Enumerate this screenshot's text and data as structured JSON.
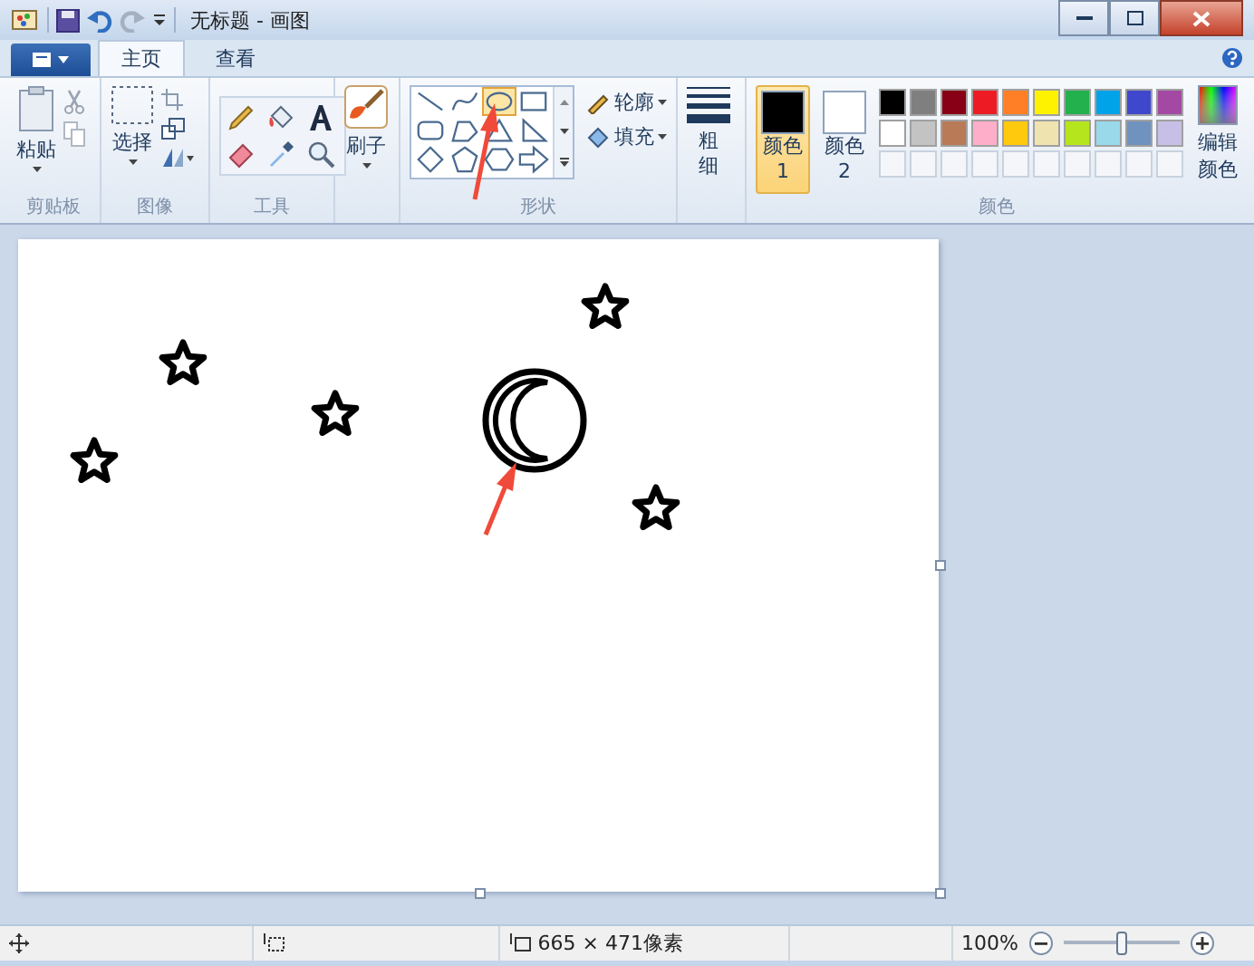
{
  "window": {
    "title": "无标题 - 画图"
  },
  "tabs": [
    {
      "label": "主页",
      "selected": true
    },
    {
      "label": "查看",
      "selected": false
    }
  ],
  "ribbon": {
    "clipboard": {
      "paste": "粘贴",
      "label": "剪贴板"
    },
    "image": {
      "select": "选择",
      "label": "图像"
    },
    "tools": {
      "label": "工具"
    },
    "brushes": {
      "label": "刷子"
    },
    "shapes": {
      "items": [
        {
          "kind": "line",
          "selected": false
        },
        {
          "kind": "curve",
          "selected": false
        },
        {
          "kind": "oval",
          "selected": true
        },
        {
          "kind": "rectangle",
          "selected": false
        },
        {
          "kind": "rounded",
          "selected": false
        },
        {
          "kind": "polygon",
          "selected": false
        },
        {
          "kind": "triangle",
          "selected": false
        },
        {
          "kind": "right-triangle",
          "selected": false
        },
        {
          "kind": "diamond",
          "selected": false
        },
        {
          "kind": "pentagon",
          "selected": false
        },
        {
          "kind": "hexagon",
          "selected": false
        },
        {
          "kind": "arrow",
          "selected": false
        }
      ],
      "outline": "轮廓",
      "fill": "填充",
      "label": "形状"
    },
    "size": {
      "label": "粗细"
    },
    "colors": {
      "color1": {
        "label": "颜色 1",
        "selected": true,
        "color": "#000000"
      },
      "color2": {
        "label": "颜色 2",
        "selected": false,
        "color": "#ffffff"
      },
      "palette": [
        {
          "color": "#000000"
        },
        {
          "color": "#7f7f7f"
        },
        {
          "color": "#880015"
        },
        {
          "color": "#ed1c24"
        },
        {
          "color": "#ff7f27"
        },
        {
          "color": "#fff200"
        },
        {
          "color": "#22b14c"
        },
        {
          "color": "#00a2e8"
        },
        {
          "color": "#3f48cc"
        },
        {
          "color": "#a349a4"
        },
        {
          "color": "#ffffff"
        },
        {
          "color": "#c3c3c3"
        },
        {
          "color": "#b97a57"
        },
        {
          "color": "#ffaec9"
        },
        {
          "color": "#ffc90e"
        },
        {
          "color": "#efe4b0"
        },
        {
          "color": "#b5e61d"
        },
        {
          "color": "#99d9ea"
        },
        {
          "color": "#7092be"
        },
        {
          "color": "#c8bfe7"
        }
      ],
      "edit": "编辑颜色",
      "label": "颜色"
    }
  },
  "status_bar": {
    "canvas_size": "665 × 471像素",
    "zoom": "100%",
    "zoom_slider": {
      "level": 0.5
    }
  }
}
